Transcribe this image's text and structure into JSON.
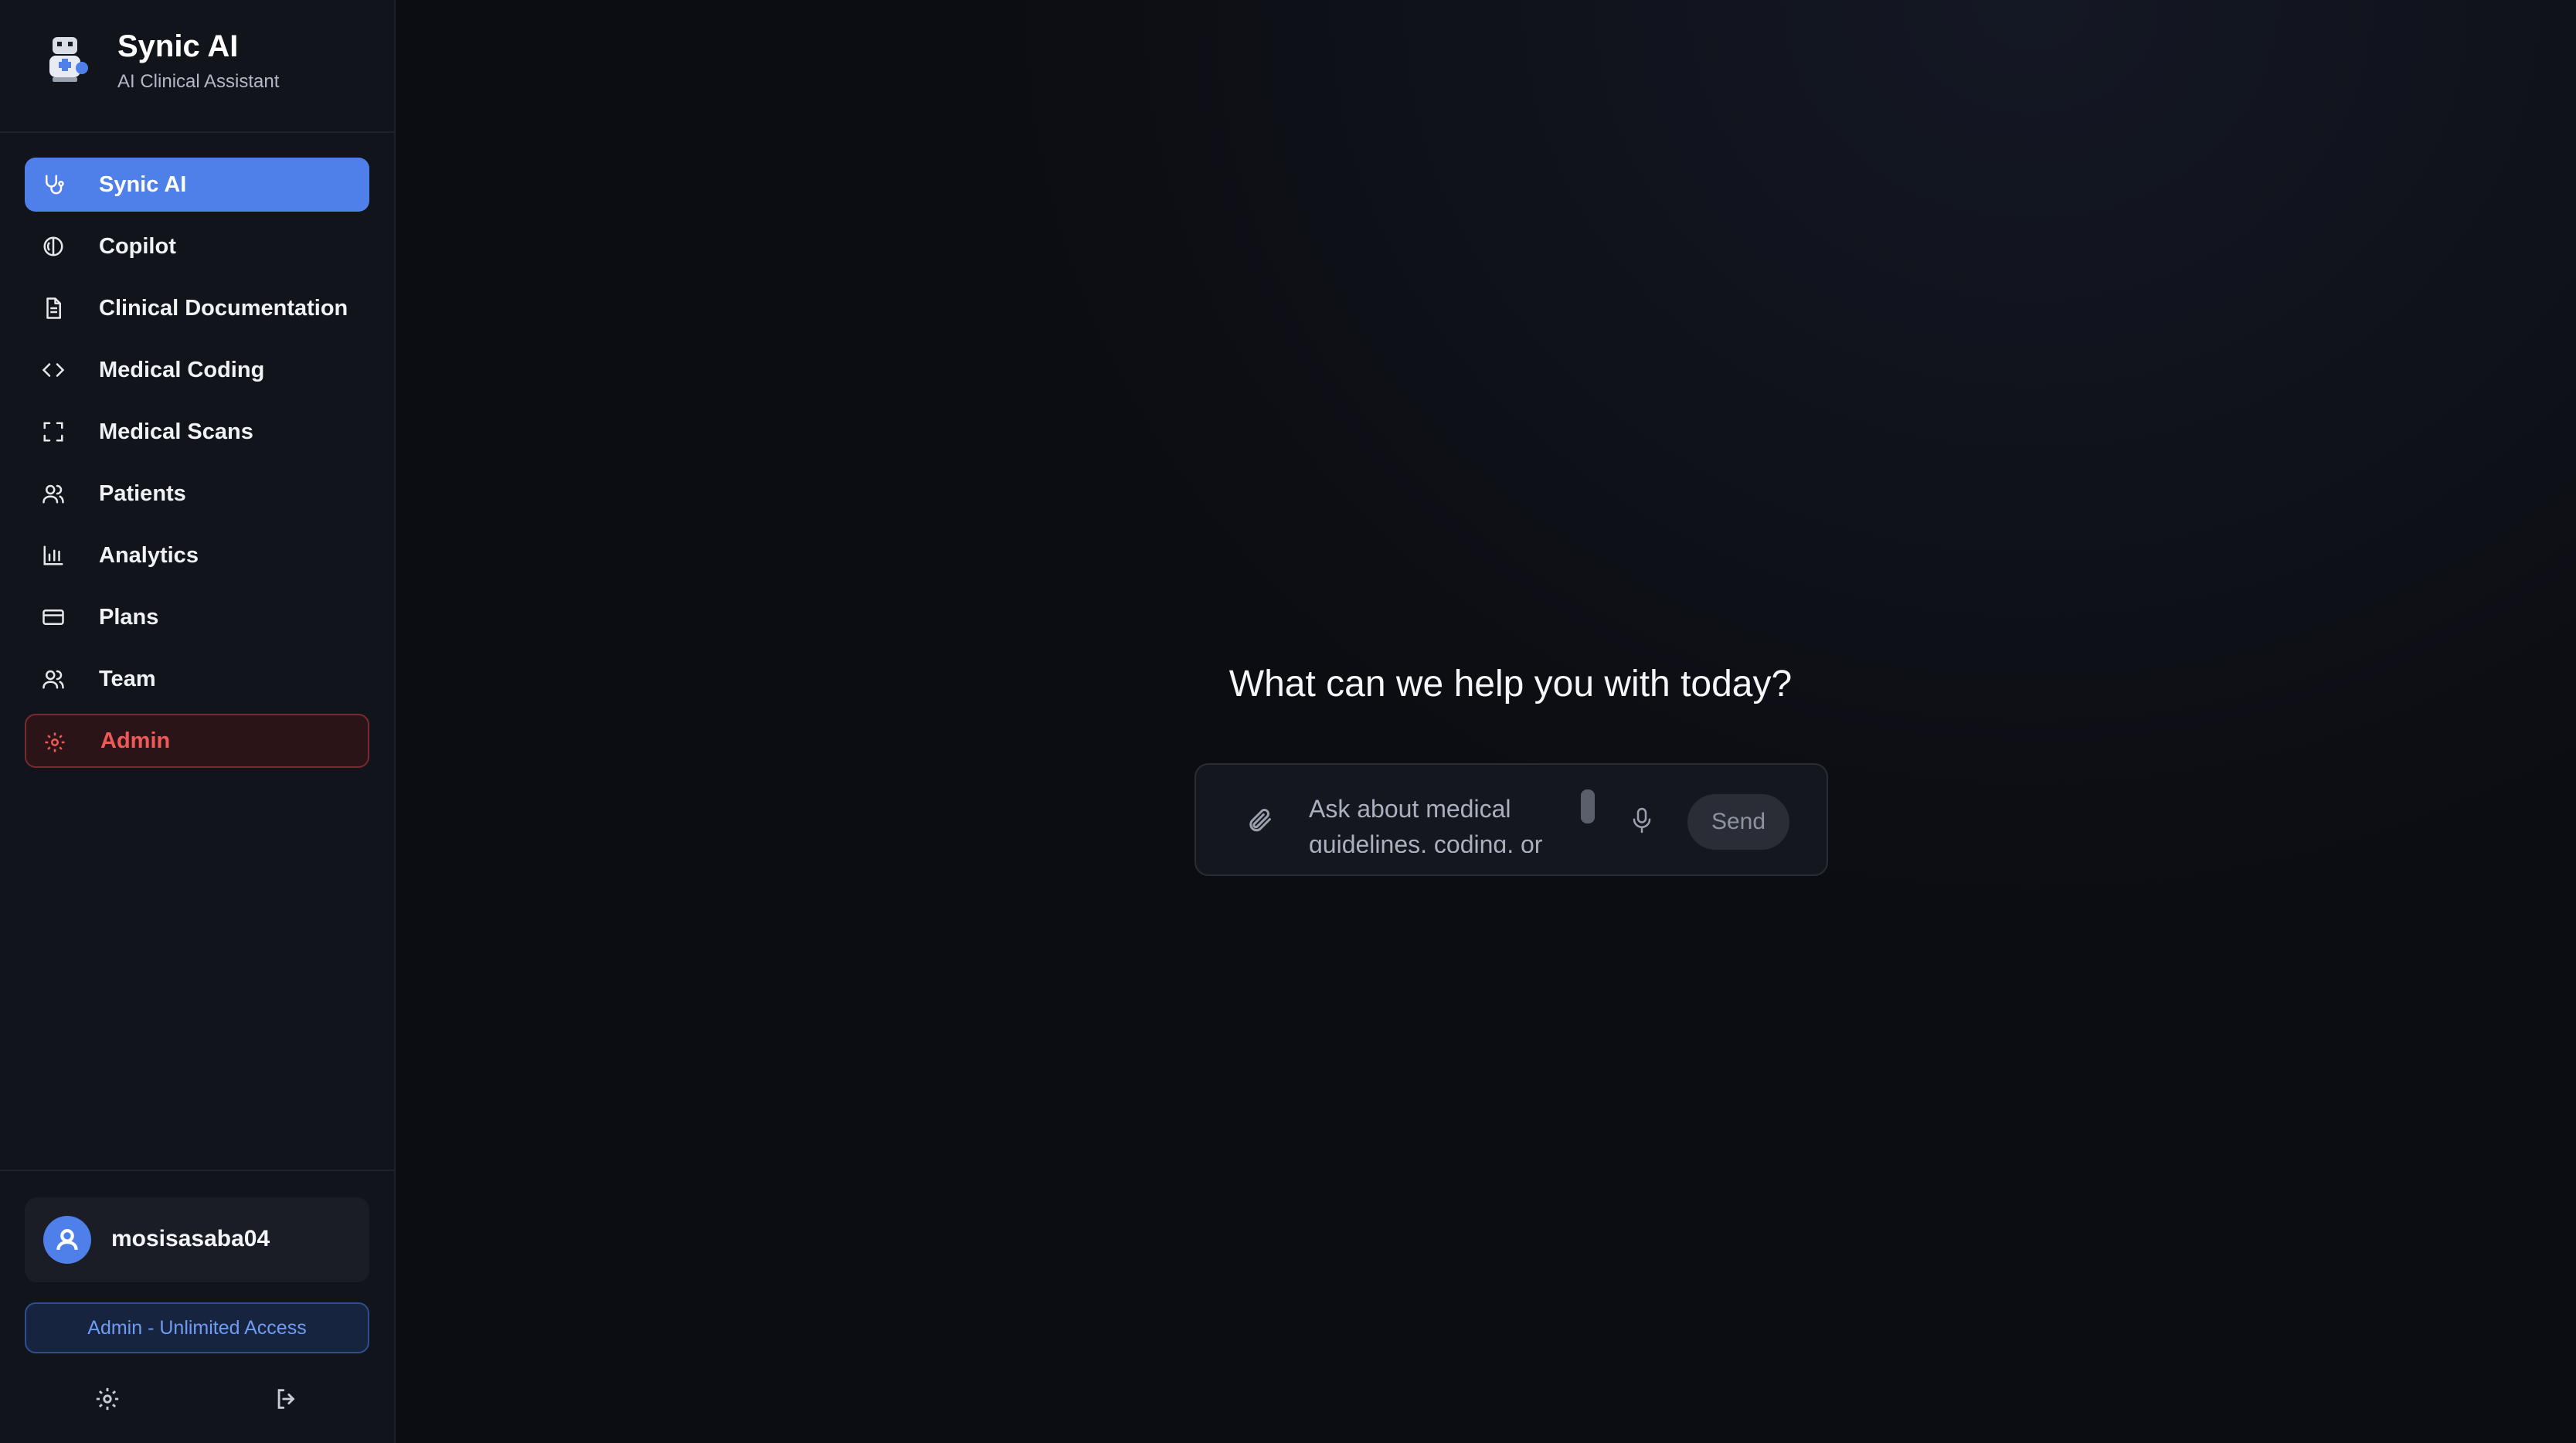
{
  "brand": {
    "title": "Synic AI",
    "subtitle": "AI Clinical Assistant",
    "logo_icon": "robot-doctor-icon"
  },
  "sidebar": {
    "items": [
      {
        "label": "Synic AI",
        "icon": "stethoscope-icon",
        "active": true
      },
      {
        "label": "Copilot",
        "icon": "brain-icon"
      },
      {
        "label": "Clinical Documentation",
        "icon": "document-icon"
      },
      {
        "label": "Medical Coding",
        "icon": "code-icon"
      },
      {
        "label": "Medical Scans",
        "icon": "scan-frame-icon"
      },
      {
        "label": "Patients",
        "icon": "users-icon"
      },
      {
        "label": "Analytics",
        "icon": "bar-chart-icon"
      },
      {
        "label": "Plans",
        "icon": "credit-card-icon"
      },
      {
        "label": "Team",
        "icon": "team-icon"
      },
      {
        "label": "Admin",
        "icon": "gear-icon",
        "danger": true
      }
    ]
  },
  "user": {
    "name": "mosisasaba04",
    "access": "Admin - Unlimited Access"
  },
  "main": {
    "headline": "What can we help you with today?",
    "composer": {
      "placeholder": "Ask about medical guidelines, coding, or",
      "send_label": "Send"
    }
  },
  "colors": {
    "accent": "#4f7fe8",
    "danger": "#ef5a57",
    "background": "#0c0d12",
    "sidebar": "#12141b"
  }
}
